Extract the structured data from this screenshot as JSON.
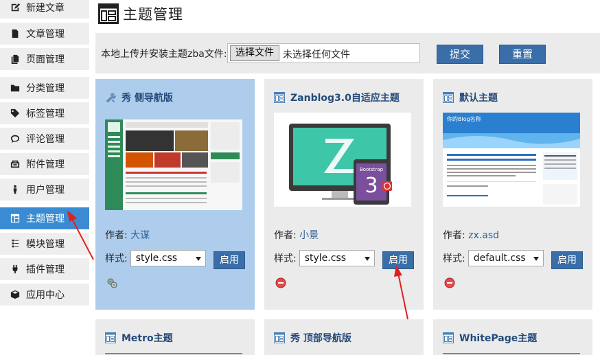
{
  "sidebar": {
    "items": [
      {
        "label": "新建文章",
        "icon": "edit-icon"
      },
      {
        "label": "文章管理",
        "icon": "file-text-icon"
      },
      {
        "label": "页面管理",
        "icon": "files-icon"
      },
      {
        "label": "分类管理",
        "icon": "folder-icon"
      },
      {
        "label": "标签管理",
        "icon": "tag-icon"
      },
      {
        "label": "评论管理",
        "icon": "comment-icon"
      },
      {
        "label": "附件管理",
        "icon": "attachment-icon"
      },
      {
        "label": "用户管理",
        "icon": "user-icon"
      },
      {
        "label": "主题管理",
        "icon": "theme-icon",
        "active": true
      },
      {
        "label": "模块管理",
        "icon": "module-icon"
      },
      {
        "label": "插件管理",
        "icon": "plugin-icon"
      },
      {
        "label": "应用中心",
        "icon": "box-icon"
      }
    ]
  },
  "header": {
    "title": "主题管理"
  },
  "upload": {
    "label": "本地上传并安装主题zba文件:",
    "choose_label": "选择文件",
    "status": "未选择任何文件",
    "submit_label": "提交",
    "reset_label": "重置"
  },
  "themes": [
    {
      "name": "秀 侧导航版",
      "author_label": "作者:",
      "author": "大谋",
      "style_label": "样式:",
      "style": "style.css",
      "enable_label": "启用",
      "active": true
    },
    {
      "name": "Zanblog3.0自适应主题",
      "author_label": "作者:",
      "author": "小景",
      "style_label": "样式:",
      "style": "style.css",
      "enable_label": "启用",
      "thumb_text": "Bootstrap",
      "thumb_number": "3"
    },
    {
      "name": "默认主题",
      "author_label": "作者:",
      "author": "zx.asd",
      "style_label": "样式:",
      "style": "default.css",
      "enable_label": "启用",
      "thumb_text": "你的Blog名称"
    },
    {
      "name": "Metro主题"
    },
    {
      "name": "秀 顶部导航版"
    },
    {
      "name": "WhitePage主题"
    }
  ],
  "colors": {
    "accent": "#3a6ea8",
    "sidebar_active": "#3a8bd2",
    "card_bg": "#ebebeb",
    "card_active_bg": "#aecdec",
    "link": "#2f5f97"
  }
}
